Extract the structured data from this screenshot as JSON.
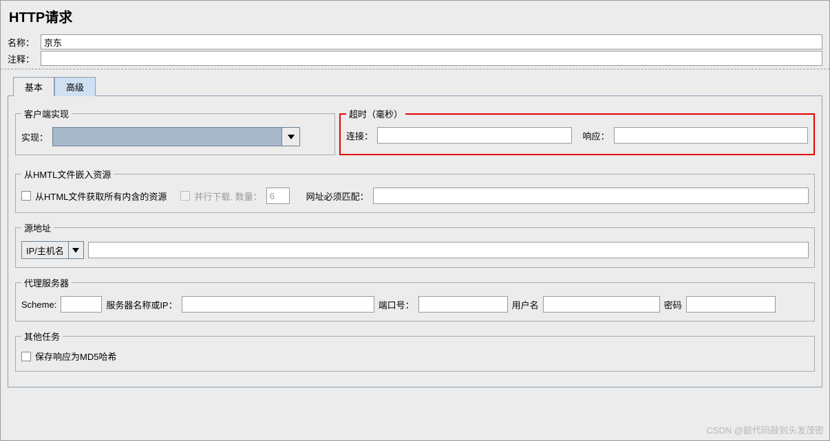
{
  "title": "HTTP请求",
  "name_label": "名称：",
  "name_value": "京东",
  "comment_label": "注释：",
  "comment_value": "",
  "tabs": {
    "basic": "基本",
    "advanced": "高级"
  },
  "client": {
    "legend": "客户端实现",
    "impl_label": "实现："
  },
  "timeout": {
    "legend": "超时（毫秒）",
    "connect_label": "连接：",
    "connect_value": "",
    "response_label": "响应：",
    "response_value": ""
  },
  "embed": {
    "legend": "从HMTL文件嵌入资源",
    "retrieve_label": "从HTML文件获取所有内含的资源",
    "parallel_label": "并行下载. 数量：",
    "parallel_value": "6",
    "match_label": "网址必须匹配：",
    "match_value": ""
  },
  "source": {
    "legend": "源地址",
    "selector": "IP/主机名",
    "value": ""
  },
  "proxy": {
    "legend": "代理服务器",
    "scheme_label": "Scheme:",
    "scheme_value": "",
    "server_label": "服务器名称或IP：",
    "server_value": "",
    "port_label": "端口号：",
    "port_value": "",
    "user_label": "用户名",
    "user_value": "",
    "pass_label": "密码",
    "pass_value": ""
  },
  "other": {
    "legend": "其他任务",
    "md5_label": "保存响应为MD5哈希"
  },
  "watermark": "CSDN @敲代码敲到头发茂密"
}
